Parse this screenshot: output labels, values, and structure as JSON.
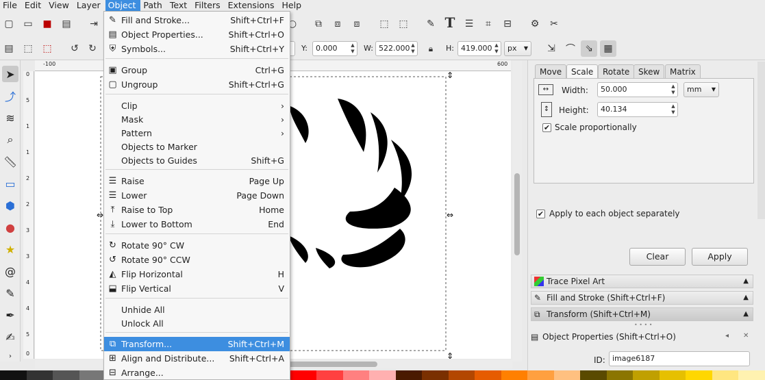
{
  "menubar": {
    "items": [
      "File",
      "Edit",
      "View",
      "Layer",
      "Object",
      "Path",
      "Text",
      "Filters",
      "Extensions",
      "Help"
    ],
    "active": "Object"
  },
  "toolbar": {
    "y_label": "Y:",
    "y_value": "0.000",
    "w_label": "W:",
    "w_value": "522.000",
    "h_label": "H:",
    "h_value": "419.000",
    "unit": "px"
  },
  "ruler": {
    "top_ticks": [
      "-100",
      "600"
    ],
    "left_ticks": [
      "0",
      "5",
      "1",
      "1",
      "2",
      "2",
      "3",
      "3",
      "4",
      "4",
      "5",
      "0"
    ]
  },
  "object_menu": {
    "items": [
      {
        "label": "Fill and Stroke...",
        "shortcut": "Shift+Ctrl+F",
        "icon": "fill-stroke-icon",
        "glyph": "✎"
      },
      {
        "label": "Object Properties...",
        "shortcut": "Shift+Ctrl+O",
        "icon": "object-properties-icon",
        "glyph": "▤"
      },
      {
        "label": "Symbols...",
        "shortcut": "Shift+Ctrl+Y",
        "icon": "symbols-icon",
        "glyph": "⛨"
      },
      {
        "label": "Group",
        "shortcut": "Ctrl+G",
        "icon": "group-icon",
        "glyph": "▣"
      },
      {
        "label": "Ungroup",
        "shortcut": "Shift+Ctrl+G",
        "icon": "ungroup-icon",
        "glyph": "▢"
      },
      {
        "label": "Clip",
        "shortcut": "›",
        "icon": "",
        "glyph": ""
      },
      {
        "label": "Mask",
        "shortcut": "›",
        "icon": "",
        "glyph": ""
      },
      {
        "label": "Pattern",
        "shortcut": "›",
        "icon": "",
        "glyph": ""
      },
      {
        "label": "Objects to Marker",
        "shortcut": "",
        "icon": "",
        "glyph": ""
      },
      {
        "label": "Objects to Guides",
        "shortcut": "Shift+G",
        "icon": "",
        "glyph": ""
      },
      {
        "label": "Raise",
        "shortcut": "Page Up",
        "icon": "raise-icon",
        "glyph": "☰"
      },
      {
        "label": "Lower",
        "shortcut": "Page Down",
        "icon": "lower-icon",
        "glyph": "☰"
      },
      {
        "label": "Raise to Top",
        "shortcut": "Home",
        "icon": "raise-to-top-icon",
        "glyph": "⤒"
      },
      {
        "label": "Lower to Bottom",
        "shortcut": "End",
        "icon": "lower-to-bottom-icon",
        "glyph": "⤓"
      },
      {
        "label": "Rotate 90° CW",
        "shortcut": "",
        "icon": "rotate-cw-icon",
        "glyph": "↻"
      },
      {
        "label": "Rotate 90° CCW",
        "shortcut": "",
        "icon": "rotate-ccw-icon",
        "glyph": "↺"
      },
      {
        "label": "Flip Horizontal",
        "shortcut": "H",
        "icon": "flip-horizontal-icon",
        "glyph": "◭"
      },
      {
        "label": "Flip Vertical",
        "shortcut": "V",
        "icon": "flip-vertical-icon",
        "glyph": "⬓"
      },
      {
        "label": "Unhide All",
        "shortcut": "",
        "icon": "",
        "glyph": ""
      },
      {
        "label": "Unlock All",
        "shortcut": "",
        "icon": "",
        "glyph": ""
      },
      {
        "label": "Transform...",
        "shortcut": "Shift+Ctrl+M",
        "icon": "transform-icon",
        "glyph": "⧉"
      },
      {
        "label": "Align and Distribute...",
        "shortcut": "Shift+Ctrl+A",
        "icon": "align-icon",
        "glyph": "⊞"
      },
      {
        "label": "Arrange...",
        "shortcut": "",
        "icon": "arrange-icon",
        "glyph": "⊟"
      }
    ],
    "highlighted": "Transform..."
  },
  "transform_panel": {
    "tabs": [
      "Move",
      "Scale",
      "Rotate",
      "Skew",
      "Matrix"
    ],
    "active_tab": "Scale",
    "width_label": "Width:",
    "width_value": "50.000",
    "height_label": "Height:",
    "height_value": "40.134",
    "unit": "mm",
    "scale_proportionally": "Scale proportionally",
    "apply_each": "Apply to each object separately",
    "clear_label": "Clear",
    "apply_label": "Apply"
  },
  "dock": {
    "trace_pixel_art": "Trace Pixel Art",
    "fill_and_stroke": "Fill and Stroke (Shift+Ctrl+F)",
    "transform": "Transform (Shift+Ctrl+M)",
    "object_properties": "Object Properties (Shift+Ctrl+O)",
    "id_label": "ID:",
    "id_value": "image6187"
  },
  "palette": [
    "#111111",
    "#333333",
    "#555555",
    "#777777",
    "#999999",
    "#bbbbbb",
    "#dddddd",
    "#ffffff",
    "#5a0000",
    "#8b0000",
    "#c00000",
    "#ff0000",
    "#ff4040",
    "#ff8080",
    "#ffb0b0",
    "#4a1a00",
    "#7a3000",
    "#b34700",
    "#e65c00",
    "#ff8000",
    "#ffa040",
    "#ffc080",
    "#5a4a00",
    "#8b7500",
    "#c0a000",
    "#e6c000",
    "#ffd700",
    "#ffe680",
    "#fff2b0"
  ]
}
